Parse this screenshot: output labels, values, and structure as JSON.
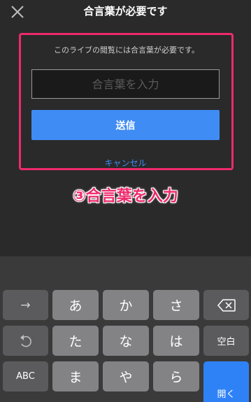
{
  "header": {
    "title": "合言葉が必要です",
    "close_icon": "close-icon"
  },
  "dialog": {
    "description": "このライブの閲覧には合言葉が必要です。",
    "input_placeholder": "合言葉を入力",
    "input_value": "",
    "submit_label": "送信",
    "cancel_label": "キャンセル"
  },
  "annotation": {
    "text": "③合言葉を入力",
    "color": "#ee2a6b"
  },
  "keyboard": {
    "keys": {
      "arrow": "→",
      "a": "あ",
      "ka": "か",
      "sa": "さ",
      "backspace_icon": "backspace-icon",
      "undo_icon": "undo-icon",
      "ta": "た",
      "na": "な",
      "ha": "は",
      "space": "空白",
      "abc": "ABC",
      "ma": "ま",
      "ya": "や",
      "ra": "ら",
      "open": "開く"
    },
    "accent_color": "#2f82f5"
  }
}
